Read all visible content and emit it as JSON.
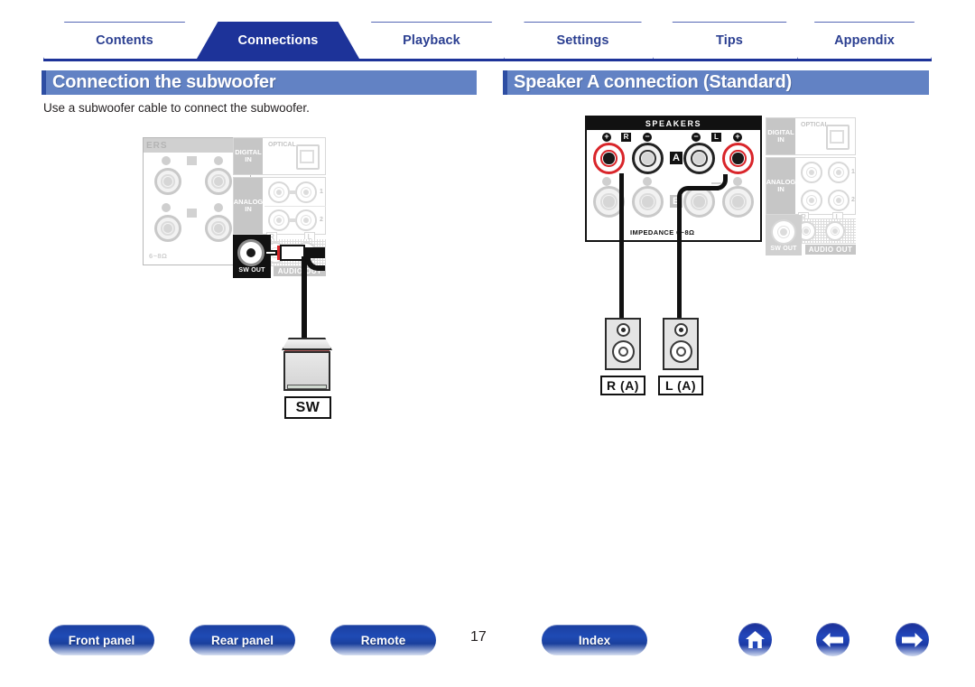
{
  "nav_tabs": [
    {
      "label": "Contents",
      "active": false
    },
    {
      "label": "Connections",
      "active": true
    },
    {
      "label": "Playback",
      "active": false
    },
    {
      "label": "Settings",
      "active": false
    },
    {
      "label": "Tips",
      "active": false
    },
    {
      "label": "Appendix",
      "active": false
    }
  ],
  "sections": {
    "left": {
      "title": "Connection the subwoofer",
      "body": "Use a subwoofer cable to connect the subwoofer.",
      "diagram": {
        "panel_speakers_label": "ERS",
        "impedance": "6~8Ω",
        "terminal_labels": [
          "L",
          "L"
        ],
        "digital_in_label": "DIGITAL\nIN",
        "optical_label": "OPTICAL",
        "analog_in_label": "ANALOG\nIN",
        "analog_channels": [
          "1",
          "2"
        ],
        "rca_rl": [
          "R",
          "L"
        ],
        "sw_out_label": "SW OUT",
        "audio_out_label": "AUDIO OUT",
        "device_label": "SW"
      }
    },
    "right": {
      "title": "Speaker A connection (Standard)",
      "diagram": {
        "speakers_header": "SPEAKERS",
        "impedance": "IMPEDANCE  6~8Ω",
        "row_a_label": "A",
        "row_b_label": "B",
        "channel_labels": [
          "R",
          "L"
        ],
        "polarity": [
          "+",
          "−",
          "−",
          "+"
        ],
        "digital_in_label": "DIGITAL\nIN",
        "optical_label": "OPTICAL",
        "analog_in_label": "ANALOG\nIN",
        "analog_channels": [
          "1",
          "2"
        ],
        "rca_rl": [
          "R",
          "L"
        ],
        "sw_out_label": "SW OUT",
        "audio_out_label": "AUDIO OUT",
        "speaker_labels": [
          "R (A)",
          "L (A)"
        ]
      }
    }
  },
  "footer": {
    "buttons": [
      {
        "label": "Front panel"
      },
      {
        "label": "Rear panel"
      },
      {
        "label": "Remote"
      },
      {
        "label": "Index"
      }
    ],
    "page_number": "17",
    "icons": [
      {
        "name": "home-icon",
        "glyph": "⌂"
      },
      {
        "name": "back-arrow-icon",
        "glyph": "←"
      },
      {
        "name": "forward-arrow-icon",
        "glyph": "→"
      }
    ]
  },
  "colors": {
    "tab_active_bg": "#1d3399",
    "tab_text": "#2b3f91",
    "title_bar": "#6282c4",
    "title_accent": "#2e4ea3",
    "terminal_active": "#d9252a",
    "cable": "#111111"
  }
}
